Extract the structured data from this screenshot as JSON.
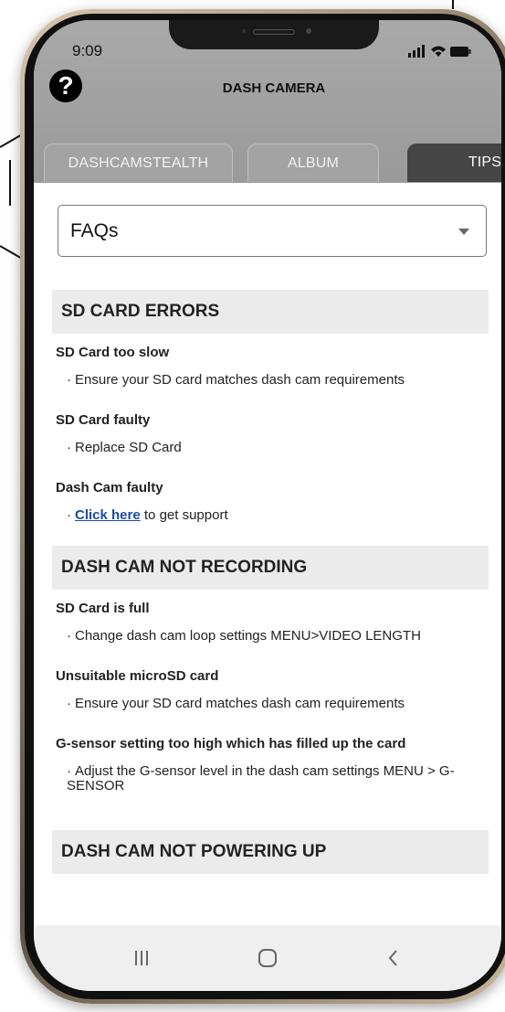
{
  "status": {
    "time": "9:09"
  },
  "header": {
    "title": "DASH CAMERA",
    "help_icon": "question-circle-icon"
  },
  "tabs": [
    {
      "label": "DASHCAMSTEALTH",
      "active": false
    },
    {
      "label": "ALBUM",
      "active": false
    },
    {
      "label": "TIPS",
      "active": true
    }
  ],
  "select": {
    "value": "FAQs"
  },
  "sections": {
    "sd": {
      "heading": "SD CARD ERRORS",
      "q1": {
        "title": "SD Card too slow",
        "item": "Ensure your SD card matches dash cam requirements"
      },
      "q2": {
        "title": "SD Card faulty",
        "item": "Replace SD Card"
      },
      "q3": {
        "title": "Dash Cam faulty",
        "link": "Click here",
        "item_suffix": " to get support"
      }
    },
    "rec": {
      "heading": "DASH CAM NOT RECORDING",
      "q1": {
        "title": "SD Card is full",
        "item": "Change dash cam loop settings MENU>VIDEO LENGTH"
      },
      "q2": {
        "title": "Unsuitable microSD card",
        "item": "Ensure your SD card matches dash cam requirements"
      },
      "q3": {
        "title": "G-sensor setting too high which has filled up the card",
        "item": "Adjust the G-sensor level in the dash cam settings MENU > G-SENSOR"
      }
    },
    "power": {
      "heading": "DASH CAM NOT POWERING UP"
    }
  },
  "colors": {
    "header_bg": "#9e9e9e",
    "active_tab": "#454545",
    "link": "#1a4aa6"
  },
  "nav": {
    "recent": "recent-apps-icon",
    "home": "home-icon",
    "back": "back-icon"
  }
}
